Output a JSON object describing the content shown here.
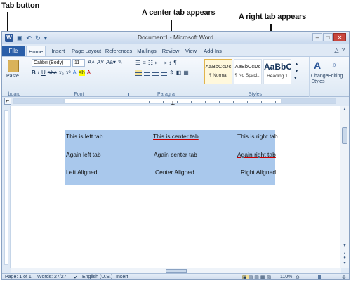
{
  "callouts": {
    "tab_button": "Tab button",
    "center_tab": "A center tab appears",
    "right_tab": "A right tab appears"
  },
  "window": {
    "title": "Document1 - Microsoft Word",
    "logo_letter": "W"
  },
  "ribbon_tabs": [
    "File",
    "Home",
    "Insert",
    "Page Layout",
    "References",
    "Mailings",
    "Review",
    "View",
    "Add-Ins"
  ],
  "ribbon": {
    "paste_label": "Paste",
    "clipboard_label": "board",
    "font_name": "Calibri (Body)",
    "font_size": "11",
    "font_label": "Font",
    "paragraph_label": "Paragra",
    "styles_label": "Styles",
    "styles": [
      {
        "sample": "AaBbCcDc",
        "name": "¶ Normal"
      },
      {
        "sample": "AaBbCcDc",
        "name": "¶ No Spaci..."
      },
      {
        "sample": "AaBbC",
        "name": "Heading 1"
      }
    ],
    "change_styles_label": "Change Styles",
    "editing_label": "Editing"
  },
  "document": {
    "rows": [
      {
        "left": "This is left tab",
        "center": "This is center tab",
        "right": "This is right tab"
      },
      {
        "left": "Again left tab",
        "center": "Again center tab",
        "right": "Again right tab"
      },
      {
        "left": "Left Aligned",
        "center": "Center Aligned",
        "right": "Right Aligned"
      }
    ]
  },
  "status": {
    "page": "Page: 1 of 1",
    "words": "Words: 27/27",
    "language": "English (U.S.)",
    "mode": "Insert",
    "zoom": "110%"
  },
  "colors": {
    "file_tab": "#2a5ea8",
    "selection": "#a9c8ec",
    "logo": "#2b579a"
  }
}
